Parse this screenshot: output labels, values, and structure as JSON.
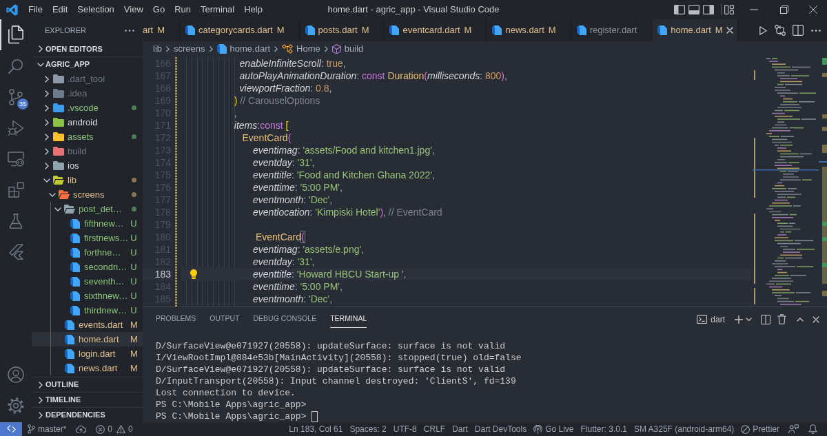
{
  "title_bar": {
    "menu": [
      "File",
      "Edit",
      "Selection",
      "View",
      "Go",
      "Run",
      "Terminal",
      "Help"
    ],
    "title": "home.dart - agric_app - Visual Studio Code"
  },
  "activity_bar": {
    "items": [
      {
        "kind": "explorer",
        "selected": true
      },
      {
        "kind": "search",
        "selected": false
      },
      {
        "kind": "source_control",
        "selected": false,
        "badge": "35"
      },
      {
        "kind": "run_debug",
        "selected": false
      },
      {
        "kind": "remote_explorer",
        "selected": false
      },
      {
        "kind": "extensions",
        "selected": false
      },
      {
        "kind": "testing",
        "selected": false
      },
      {
        "kind": "flutter",
        "selected": false
      }
    ],
    "bottom": [
      {
        "kind": "accounts"
      },
      {
        "kind": "manage"
      }
    ]
  },
  "sidebar": {
    "title": "EXPLORER",
    "sections": [
      {
        "title": "OPEN EDITORS",
        "expanded": false
      },
      {
        "title": "AGRIC_APP",
        "expanded": true,
        "items": [
          {
            "name": ".dart_tool",
            "kind": "folder",
            "expanded": false,
            "selected": false,
            "ignored": true,
            "color": "#8d99a6"
          },
          {
            "name": ".idea",
            "kind": "folder",
            "expanded": false,
            "selected": false,
            "ignored": true,
            "color": "#6b7b8c"
          },
          {
            "name": ".vscode",
            "kind": "folder",
            "expanded": false,
            "selected": false,
            "untracked": true,
            "color": "#3d9be9"
          },
          {
            "name": "android",
            "kind": "folder",
            "expanded": false,
            "selected": false,
            "color": "#8bc34a"
          },
          {
            "name": "assets",
            "kind": "folder",
            "expanded": false,
            "selected": false,
            "untracked": true,
            "color": "#fbc02d"
          },
          {
            "name": "build",
            "kind": "folder",
            "expanded": false,
            "selected": false,
            "ignored": true,
            "color": "#e57373"
          },
          {
            "name": "ios",
            "kind": "folder",
            "expanded": false,
            "selected": false,
            "color": "#90a4ae"
          },
          {
            "name": "lib",
            "kind": "folder",
            "expanded": true,
            "selected": false,
            "modified": true,
            "color": "#c0ca33",
            "children": [
              {
                "name": "screens",
                "kind": "folder",
                "expanded": true,
                "selected": false,
                "modified": true,
                "color": "#ff7043",
                "children": [
                  {
                    "name": "post_det…",
                    "kind": "folder",
                    "expanded": true,
                    "selected": false,
                    "untracked": true,
                    "color": "#90a4ae",
                    "children": [
                      {
                        "name": "fifthnew…",
                        "kind": "file",
                        "selected": false,
                        "untracked": true,
                        "badge": "U"
                      },
                      {
                        "name": "firstnews…",
                        "kind": "file",
                        "selected": false,
                        "untracked": true,
                        "badge": "U"
                      },
                      {
                        "name": "forthne…",
                        "kind": "file",
                        "selected": false,
                        "untracked": true,
                        "badge": "U"
                      },
                      {
                        "name": "secondn…",
                        "kind": "file",
                        "selected": false,
                        "untracked": true,
                        "badge": "U"
                      },
                      {
                        "name": "seventh…",
                        "kind": "file",
                        "selected": false,
                        "untracked": true,
                        "badge": "U"
                      },
                      {
                        "name": "sixthnew…",
                        "kind": "file",
                        "selected": false,
                        "untracked": true,
                        "badge": "U"
                      },
                      {
                        "name": "thirdnew…",
                        "kind": "file",
                        "selected": false,
                        "untracked": true,
                        "badge": "U"
                      }
                    ]
                  },
                  {
                    "name": "events.dart",
                    "kind": "file",
                    "selected": false,
                    "modified": true,
                    "badge": "M"
                  },
                  {
                    "name": "home.dart",
                    "kind": "file",
                    "selected": true,
                    "modified": true,
                    "badge": "M"
                  },
                  {
                    "name": "login.dart",
                    "kind": "file",
                    "selected": false,
                    "modified": true,
                    "badge": "M"
                  },
                  {
                    "name": "news.dart",
                    "kind": "file",
                    "selected": false,
                    "modified": true,
                    "badge": "M"
                  }
                ]
              }
            ]
          }
        ]
      },
      {
        "title": "OUTLINE",
        "expanded": false
      },
      {
        "title": "TIMELINE",
        "expanded": false
      },
      {
        "title": "DEPENDENCIES",
        "expanded": false
      }
    ]
  },
  "tabs": [
    {
      "label": "art",
      "badge": "M",
      "modified": true,
      "selected": false,
      "clipped": true
    },
    {
      "label": "categorycards.dart",
      "badge": "M",
      "modified": true,
      "selected": false,
      "clipped": false
    },
    {
      "label": "posts.dart",
      "badge": "M",
      "modified": true,
      "selected": false,
      "clipped": false
    },
    {
      "label": "eventcard.dart",
      "badge": "M",
      "modified": true,
      "selected": false,
      "clipped": false
    },
    {
      "label": "news.dart",
      "badge": "M",
      "modified": true,
      "selected": false,
      "clipped": false
    },
    {
      "label": "register.dart",
      "modified": false,
      "selected": false,
      "clipped": false
    },
    {
      "label": "home.dart",
      "badge": "M",
      "modified": true,
      "selected": true,
      "clipped": false
    }
  ],
  "breadcrumbs": [
    {
      "label": "lib",
      "kind": "folder"
    },
    {
      "label": "screens",
      "kind": "folder"
    },
    {
      "label": "home.dart",
      "kind": "file"
    },
    {
      "label": "Home",
      "kind": "class"
    },
    {
      "label": "build",
      "kind": "method"
    }
  ],
  "editor": {
    "lines": [
      {
        "number": "166",
        "current": false,
        "tokens": [
          {
            "kind": "prop",
            "text": "                      enableInfiniteScroll"
          },
          {
            "kind": "punct",
            "text": ": "
          },
          {
            "kind": "number",
            "text": "true"
          },
          {
            "kind": "punct",
            "text": ","
          }
        ]
      },
      {
        "number": "167",
        "current": false,
        "tokens": [
          {
            "kind": "prop",
            "text": "                      autoPlayAnimationDuration"
          },
          {
            "kind": "punct",
            "text": ": "
          },
          {
            "kind": "keyword",
            "text": "const "
          },
          {
            "kind": "type",
            "text": "Duration"
          },
          {
            "kind": "bracket2",
            "text": "("
          },
          {
            "kind": "prop",
            "text": "milliseconds"
          },
          {
            "kind": "punct",
            "text": ": "
          },
          {
            "kind": "number",
            "text": "800"
          },
          {
            "kind": "bracket2",
            "text": ")"
          },
          {
            "kind": "punct",
            "text": ","
          }
        ]
      },
      {
        "number": "168",
        "current": false,
        "tokens": [
          {
            "kind": "prop",
            "text": "                      viewportFraction"
          },
          {
            "kind": "punct",
            "text": ": "
          },
          {
            "kind": "number",
            "text": "0.8"
          },
          {
            "kind": "punct",
            "text": ","
          }
        ]
      },
      {
        "number": "169",
        "current": false,
        "tokens": [
          {
            "kind": "bracket1",
            "text": "                    )"
          },
          {
            "kind": "comment",
            "text": " // CarouselOptions"
          }
        ]
      },
      {
        "number": "170",
        "current": false,
        "tokens": [
          {
            "kind": "punct",
            "text": "                    ,"
          }
        ]
      },
      {
        "number": "171",
        "current": false,
        "tokens": [
          {
            "kind": "prop",
            "text": "                    items"
          },
          {
            "kind": "punct",
            "text": ":"
          },
          {
            "kind": "keyword",
            "text": "const "
          },
          {
            "kind": "bracket1",
            "text": "["
          }
        ]
      },
      {
        "number": "172",
        "current": false,
        "tokens": [
          {
            "kind": "type",
            "text": "                       EventCard"
          },
          {
            "kind": "bracket2",
            "text": "("
          }
        ]
      },
      {
        "number": "173",
        "current": false,
        "tokens": [
          {
            "kind": "prop",
            "text": "                           eventimag"
          },
          {
            "kind": "punct",
            "text": ": "
          },
          {
            "kind": "string",
            "text": "'assets/Food and kitchen1.jpg'"
          },
          {
            "kind": "punct",
            "text": ","
          }
        ]
      },
      {
        "number": "174",
        "current": false,
        "tokens": [
          {
            "kind": "prop",
            "text": "                           eventday"
          },
          {
            "kind": "punct",
            "text": ": "
          },
          {
            "kind": "string",
            "text": "'31'"
          },
          {
            "kind": "punct",
            "text": ","
          }
        ]
      },
      {
        "number": "175",
        "current": false,
        "tokens": [
          {
            "kind": "prop",
            "text": "                           eventtitle"
          },
          {
            "kind": "punct",
            "text": ": "
          },
          {
            "kind": "string",
            "text": "'Food and Kitchen Ghana 2022'"
          },
          {
            "kind": "punct",
            "text": ","
          }
        ]
      },
      {
        "number": "176",
        "current": false,
        "tokens": [
          {
            "kind": "prop",
            "text": "                           eventtime"
          },
          {
            "kind": "punct",
            "text": ": "
          },
          {
            "kind": "string",
            "text": "'5:00 PM'"
          },
          {
            "kind": "punct",
            "text": ","
          }
        ]
      },
      {
        "number": "177",
        "current": false,
        "tokens": [
          {
            "kind": "prop",
            "text": "                           eventmonth"
          },
          {
            "kind": "punct",
            "text": ": "
          },
          {
            "kind": "string",
            "text": "'Dec'"
          },
          {
            "kind": "punct",
            "text": ","
          }
        ]
      },
      {
        "number": "178",
        "current": false,
        "tokens": [
          {
            "kind": "prop",
            "text": "                           eventlocation"
          },
          {
            "kind": "punct",
            "text": ": "
          },
          {
            "kind": "string",
            "text": "'Kimpiski Hotel'"
          },
          {
            "kind": "bracket2",
            "text": ")"
          },
          {
            "kind": "punct",
            "text": ", "
          },
          {
            "kind": "comment",
            "text": "// EventCard"
          }
        ]
      },
      {
        "number": "179",
        "current": false
      },
      {
        "number": "180",
        "current": false,
        "tokens": [
          {
            "kind": "type",
            "text": "                            EventCard"
          },
          {
            "kind": "bracket2",
            "text": "(",
            "match": true
          }
        ]
      },
      {
        "number": "181",
        "current": false,
        "tokens": [
          {
            "kind": "prop",
            "text": "                           eventimag"
          },
          {
            "kind": "punct",
            "text": ": "
          },
          {
            "kind": "string",
            "text": "'assets/e.png'"
          },
          {
            "kind": "punct",
            "text": ","
          }
        ]
      },
      {
        "number": "182",
        "current": false,
        "tokens": [
          {
            "kind": "prop",
            "text": "                           eventday"
          },
          {
            "kind": "punct",
            "text": ": "
          },
          {
            "kind": "string",
            "text": "'31'"
          },
          {
            "kind": "punct",
            "text": ","
          }
        ]
      },
      {
        "number": "183",
        "current": true,
        "lightbulb": true,
        "tokens": [
          {
            "kind": "prop",
            "text": "                           eventtitle"
          },
          {
            "kind": "punct",
            "text": ": "
          },
          {
            "kind": "string",
            "text": "'Howard HBCU Start-up '"
          },
          {
            "kind": "punct",
            "text": ","
          }
        ]
      },
      {
        "number": "184",
        "current": false,
        "tokens": [
          {
            "kind": "prop",
            "text": "                           eventtime"
          },
          {
            "kind": "punct",
            "text": ": "
          },
          {
            "kind": "string",
            "text": "'5:00 PM'"
          },
          {
            "kind": "punct",
            "text": ","
          }
        ]
      },
      {
        "number": "185",
        "current": false,
        "tokens": [
          {
            "kind": "prop",
            "text": "                           eventmonth"
          },
          {
            "kind": "punct",
            "text": ": "
          },
          {
            "kind": "string",
            "text": "'Dec'"
          },
          {
            "kind": "punct",
            "text": ","
          }
        ]
      }
    ]
  },
  "panel": {
    "tabs": [
      {
        "label": "PROBLEMS",
        "selected": false
      },
      {
        "label": "OUTPUT",
        "selected": false
      },
      {
        "label": "DEBUG CONSOLE",
        "selected": false
      },
      {
        "label": "TERMINAL",
        "selected": true
      }
    ],
    "terminal_name": "dart",
    "terminal": {
      "lines": [
        "D/SurfaceView@e071927(20558): updateSurface: surface is not valid",
        "I/ViewRootImpl@884e53b[MainActivity](20558): stopped(true) old=false",
        "D/SurfaceView@e071927(20558): updateSurface: surface is not valid",
        "D/InputTransport(20558): Input channel destroyed: 'ClientS', fd=139",
        "Lost connection to device.",
        "PS C:\\Mobile Apps\\agric_app>",
        "PS C:\\Mobile Apps\\agric_app>"
      ],
      "cursor": true
    }
  },
  "status_bar": {
    "branch": "master*",
    "errors": "0",
    "warnings": "0",
    "items": [
      {
        "kind": "text",
        "text": "Ln 183, Col 61"
      },
      {
        "kind": "text",
        "text": "Spaces: 2"
      },
      {
        "kind": "text",
        "text": "UTF-8"
      },
      {
        "kind": "text",
        "text": "CRLF"
      },
      {
        "kind": "text",
        "text": "Dart"
      },
      {
        "kind": "text",
        "text": "Dart DevTools"
      },
      {
        "kind": "live",
        "text": "Go Live"
      },
      {
        "kind": "text",
        "text": "Flutter: 3.0.1"
      },
      {
        "kind": "text",
        "text": "SM A325F (android-arm64)"
      },
      {
        "kind": "formatter",
        "text": "Prettier"
      }
    ]
  }
}
